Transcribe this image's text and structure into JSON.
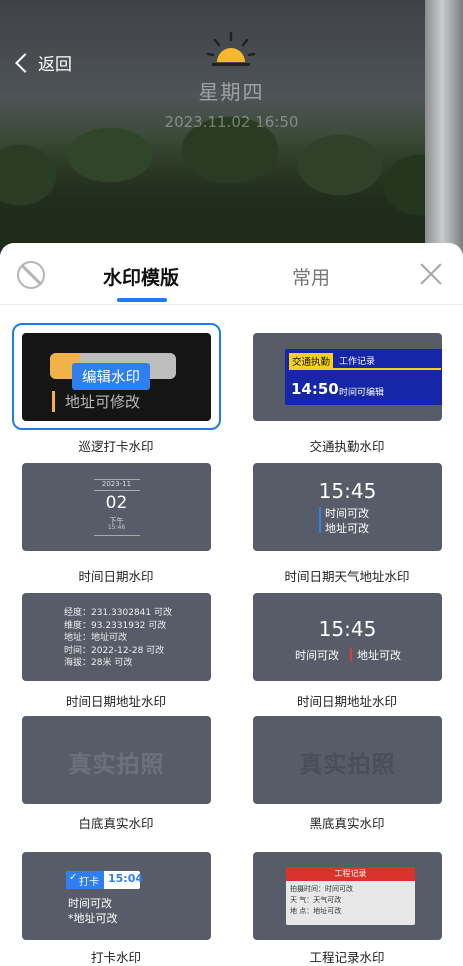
{
  "preview": {
    "back_label": "返回",
    "weekday": "星期四",
    "datetime": "2023.11.02 16:50"
  },
  "sheet": {
    "tabs": [
      "水印模版",
      "常用"
    ],
    "active_tab": 0
  },
  "templates": [
    {
      "label": "巡逻打卡水印",
      "selected": true,
      "preview": {
        "edit_label": "编辑水印",
        "address": "地址可修改"
      }
    },
    {
      "label": "交通执勤水印",
      "preview": {
        "tag": "交通执勤",
        "record": "工作记录",
        "time": "14:50",
        "note": "时间可编辑"
      }
    },
    {
      "label": "时间日期水印",
      "preview": {
        "month": "2023-11",
        "day": "02",
        "period": "下午",
        "time": "15:46"
      }
    },
    {
      "label": "时间日期天气地址水印",
      "preview": {
        "time": "15:45",
        "line1": "时间可改",
        "line2": "地址可改"
      }
    },
    {
      "label": "时间日期地址水印",
      "preview": {
        "rows": [
          "经度：231.3302841 可改",
          "维度：93.2331932  可改",
          "地址：地址可改",
          "时间：2022-12-28 可改",
          "海拔：28米 可改"
        ]
      }
    },
    {
      "label": "时间日期地址水印",
      "preview": {
        "time": "15:45",
        "left": "时间可改",
        "right": "地址可改"
      }
    },
    {
      "label": "白底真实水印",
      "preview": {
        "text": "真实拍照"
      }
    },
    {
      "label": "黑底真实水印",
      "preview": {
        "text": "真实拍照"
      }
    },
    {
      "label": "打卡水印",
      "preview": {
        "badge": "打卡",
        "time": "15:04",
        "line1": "时间可改",
        "line2": "*地址可改"
      }
    },
    {
      "label": "工程记录水印",
      "preview": {
        "header": "工程记录",
        "rows": [
          "拍摄时间：时间可改",
          "天    气：天气可改",
          "地    点：地址可改"
        ]
      }
    }
  ],
  "colors": {
    "accent": "#1e7bf0",
    "card_bg": "#575c68"
  }
}
